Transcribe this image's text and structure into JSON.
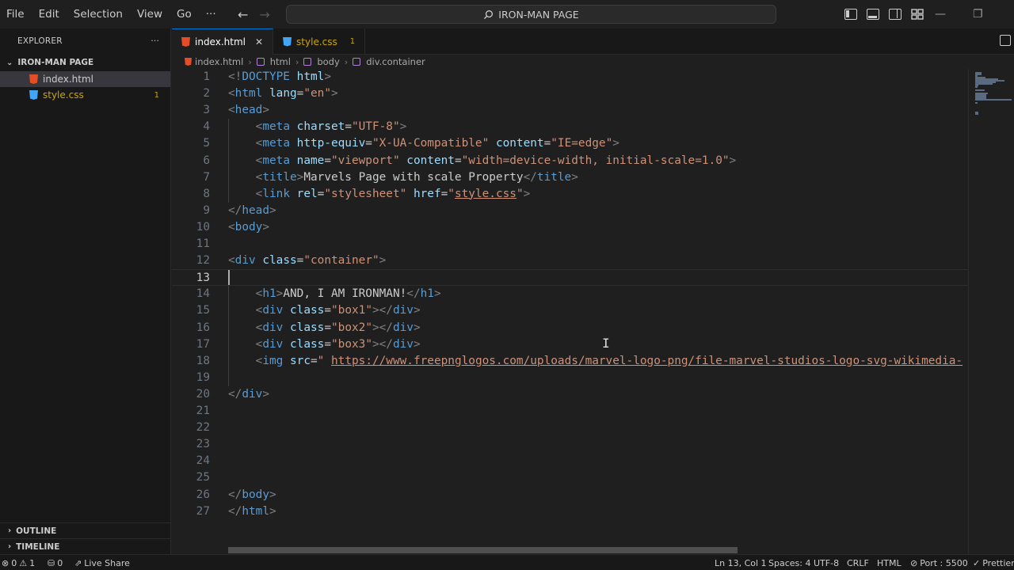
{
  "menu": [
    "File",
    "Edit",
    "Selection",
    "View",
    "Go",
    "···"
  ],
  "search": {
    "text": "IRON-MAN PAGE"
  },
  "window_controls": {
    "minimize": "—",
    "restore": "❐"
  },
  "explorer": {
    "header": "EXPLORER",
    "more": "···",
    "folder": "IRON-MAN PAGE",
    "files": [
      {
        "name": "index.html",
        "icon": "html-file-icon",
        "active": true,
        "badge": ""
      },
      {
        "name": "style.css",
        "icon": "css-file-icon",
        "active": false,
        "badge": "1"
      }
    ],
    "outline": "OUTLINE",
    "timeline": "TIMELINE"
  },
  "tabs": [
    {
      "label": "index.html",
      "close": "✕"
    },
    {
      "label": "style.css",
      "badge": "1"
    }
  ],
  "breadcrumb": [
    "index.html",
    "html",
    "body",
    "div.container"
  ],
  "editor": {
    "current_line": 13,
    "lines": [
      [
        [
          "br",
          "<!"
        ],
        [
          "tag",
          "DOCTYPE"
        ],
        [
          "txt",
          " "
        ],
        [
          "attr",
          "html"
        ],
        [
          "br",
          ">"
        ]
      ],
      [
        [
          "br",
          "<"
        ],
        [
          "tag",
          "html"
        ],
        [
          "txt",
          " "
        ],
        [
          "attr",
          "lang"
        ],
        [
          "txt",
          "="
        ],
        [
          "str",
          "\"en\""
        ],
        [
          "br",
          ">"
        ]
      ],
      [
        [
          "br",
          "<"
        ],
        [
          "tag",
          "head"
        ],
        [
          "br",
          ">"
        ]
      ],
      [
        [
          "txt",
          "    "
        ],
        [
          "br",
          "<"
        ],
        [
          "tag",
          "meta"
        ],
        [
          "txt",
          " "
        ],
        [
          "attr",
          "charset"
        ],
        [
          "txt",
          "="
        ],
        [
          "str",
          "\"UTF-8\""
        ],
        [
          "br",
          ">"
        ]
      ],
      [
        [
          "txt",
          "    "
        ],
        [
          "br",
          "<"
        ],
        [
          "tag",
          "meta"
        ],
        [
          "txt",
          " "
        ],
        [
          "attr",
          "http-equiv"
        ],
        [
          "txt",
          "="
        ],
        [
          "str",
          "\"X-UA-Compatible\""
        ],
        [
          "txt",
          " "
        ],
        [
          "attr",
          "content"
        ],
        [
          "txt",
          "="
        ],
        [
          "str",
          "\"IE=edge\""
        ],
        [
          "br",
          ">"
        ]
      ],
      [
        [
          "txt",
          "    "
        ],
        [
          "br",
          "<"
        ],
        [
          "tag",
          "meta"
        ],
        [
          "txt",
          " "
        ],
        [
          "attr",
          "name"
        ],
        [
          "txt",
          "="
        ],
        [
          "str",
          "\"viewport\""
        ],
        [
          "txt",
          " "
        ],
        [
          "attr",
          "content"
        ],
        [
          "txt",
          "="
        ],
        [
          "str",
          "\"width=device-width, initial-scale=1.0\""
        ],
        [
          "br",
          ">"
        ]
      ],
      [
        [
          "txt",
          "    "
        ],
        [
          "br",
          "<"
        ],
        [
          "tag",
          "title"
        ],
        [
          "br",
          ">"
        ],
        [
          "txt",
          "Marvels Page with scale Property"
        ],
        [
          "br",
          "</"
        ],
        [
          "tag",
          "title"
        ],
        [
          "br",
          ">"
        ]
      ],
      [
        [
          "txt",
          "    "
        ],
        [
          "br",
          "<"
        ],
        [
          "tag",
          "link"
        ],
        [
          "txt",
          " "
        ],
        [
          "attr",
          "rel"
        ],
        [
          "txt",
          "="
        ],
        [
          "str",
          "\"stylesheet\""
        ],
        [
          "txt",
          " "
        ],
        [
          "attr",
          "href"
        ],
        [
          "txt",
          "="
        ],
        [
          "str",
          "\""
        ],
        [
          "link",
          "style.css"
        ],
        [
          "str",
          "\""
        ],
        [
          "br",
          ">"
        ]
      ],
      [
        [
          "br",
          "</"
        ],
        [
          "tag",
          "head"
        ],
        [
          "br",
          ">"
        ]
      ],
      [
        [
          "br",
          "<"
        ],
        [
          "tag",
          "body"
        ],
        [
          "br",
          ">"
        ]
      ],
      [],
      [
        [
          "br",
          "<"
        ],
        [
          "tag",
          "div"
        ],
        [
          "txt",
          " "
        ],
        [
          "attr",
          "class"
        ],
        [
          "txt",
          "="
        ],
        [
          "str",
          "\"container\""
        ],
        [
          "br",
          ">"
        ]
      ],
      [],
      [
        [
          "txt",
          "    "
        ],
        [
          "br",
          "<"
        ],
        [
          "tag",
          "h1"
        ],
        [
          "br",
          ">"
        ],
        [
          "txt",
          "AND, I AM IRONMAN!"
        ],
        [
          "br",
          "</"
        ],
        [
          "tag",
          "h1"
        ],
        [
          "br",
          ">"
        ]
      ],
      [
        [
          "txt",
          "    "
        ],
        [
          "br",
          "<"
        ],
        [
          "tag",
          "div"
        ],
        [
          "txt",
          " "
        ],
        [
          "attr",
          "class"
        ],
        [
          "txt",
          "="
        ],
        [
          "str",
          "\"box1\""
        ],
        [
          "br",
          "></"
        ],
        [
          "tag",
          "div"
        ],
        [
          "br",
          ">"
        ]
      ],
      [
        [
          "txt",
          "    "
        ],
        [
          "br",
          "<"
        ],
        [
          "tag",
          "div"
        ],
        [
          "txt",
          " "
        ],
        [
          "attr",
          "class"
        ],
        [
          "txt",
          "="
        ],
        [
          "str",
          "\"box2\""
        ],
        [
          "br",
          "></"
        ],
        [
          "tag",
          "div"
        ],
        [
          "br",
          ">"
        ]
      ],
      [
        [
          "txt",
          "    "
        ],
        [
          "br",
          "<"
        ],
        [
          "tag",
          "div"
        ],
        [
          "txt",
          " "
        ],
        [
          "attr",
          "class"
        ],
        [
          "txt",
          "="
        ],
        [
          "str",
          "\"box3\""
        ],
        [
          "br",
          "></"
        ],
        [
          "tag",
          "div"
        ],
        [
          "br",
          ">"
        ]
      ],
      [
        [
          "txt",
          "    "
        ],
        [
          "br",
          "<"
        ],
        [
          "tag",
          "img"
        ],
        [
          "txt",
          " "
        ],
        [
          "attr",
          "src"
        ],
        [
          "txt",
          "="
        ],
        [
          "str",
          "\" "
        ],
        [
          "link",
          "https://www.freepnglogos.com/uploads/marvel-logo-png/file-marvel-studios-logo-svg-wikimedia-"
        ]
      ],
      [],
      [
        [
          "br",
          "</"
        ],
        [
          "tag",
          "div"
        ],
        [
          "br",
          ">"
        ]
      ],
      [],
      [],
      [],
      [],
      [],
      [
        [
          "br",
          "</"
        ],
        [
          "tag",
          "body"
        ],
        [
          "br",
          ">"
        ]
      ],
      [
        [
          "br",
          "</"
        ],
        [
          "tag",
          "html"
        ],
        [
          "br",
          ">"
        ]
      ]
    ]
  },
  "status": {
    "errors": "0",
    "warnings": "1",
    "ports": "0",
    "live_share": "Live Share",
    "position": "Ln 13, Col 1",
    "spaces": "Spaces: 4",
    "encoding": "UTF-8",
    "eol": "CRLF",
    "language": "HTML",
    "port": "Port : 5500",
    "prettier": "Prettier"
  },
  "colors": {
    "tag": "#569cd6",
    "attr": "#9cdcfe",
    "string": "#ce9178",
    "bracket": "#808080",
    "accent": "#0078d4"
  }
}
